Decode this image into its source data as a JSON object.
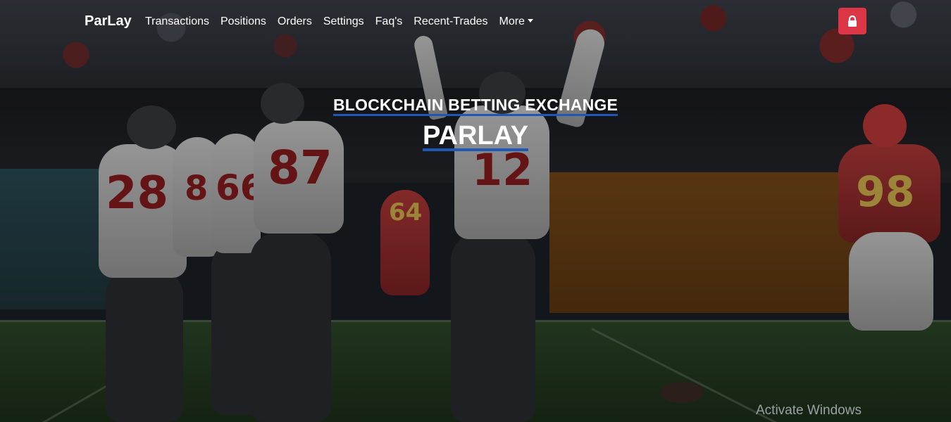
{
  "navbar": {
    "brand": "ParLay",
    "links": [
      "Transactions",
      "Positions",
      "Orders",
      "Settings",
      "Faq's",
      "Recent-Trades"
    ],
    "more_label": "More",
    "lock_icon": "lock-icon",
    "lock_color": "#dc3545"
  },
  "hero": {
    "subtitle": "BLOCKCHAIN BETTING EXCHANGE",
    "title": "PARLAY",
    "underline_color": "#1f57b8",
    "jersey_numbers": [
      "28",
      "8",
      "66",
      "87",
      "12",
      "64",
      "98"
    ]
  },
  "watermark": "Activate Windows"
}
